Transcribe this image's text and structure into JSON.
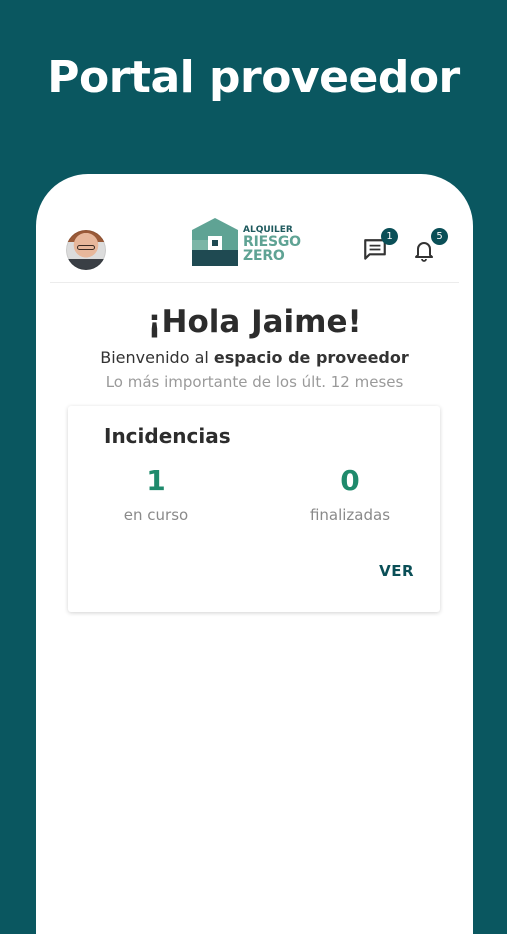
{
  "promo": {
    "title": "Portal proveedor"
  },
  "header": {
    "logo": {
      "line1": "ALQUILER",
      "line2": "RIESGO",
      "line3": "ZERO"
    },
    "messages": {
      "icon": "chat-icon",
      "badge": "1"
    },
    "notifications": {
      "icon": "bell-icon",
      "badge": "5"
    },
    "avatar": {
      "icon": "user-avatar"
    }
  },
  "main": {
    "greeting": "¡Hola Jaime!",
    "welcome_prefix": "Bienvenido al",
    "welcome_bold": "espacio de proveedor",
    "subtitle": "Lo más importante de los últ. 12 meses"
  },
  "incidencias": {
    "title": "Incidencias",
    "in_progress": {
      "value": "1",
      "label": "en curso"
    },
    "finished": {
      "value": "0",
      "label": "finalizadas"
    },
    "link": "VER"
  },
  "colors": {
    "background": "#0a5760",
    "accent_green": "#1f8a6c",
    "dark_teal": "#0a4f57",
    "logo_green": "#5fa394"
  }
}
